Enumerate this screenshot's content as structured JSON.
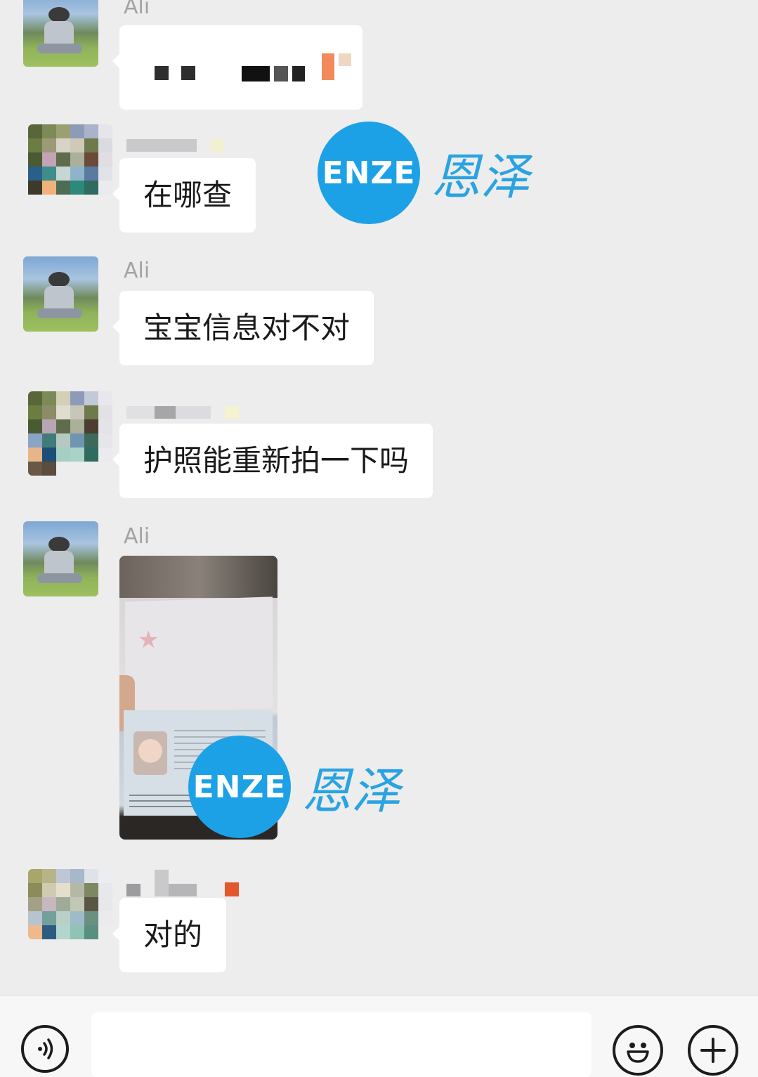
{
  "messages": [
    {
      "sender": "Ali",
      "type": "text",
      "text": ""
    },
    {
      "sender": "",
      "type": "text",
      "text": "在哪查"
    },
    {
      "sender": "Ali",
      "type": "text",
      "text": "宝宝信息对不对"
    },
    {
      "sender": "",
      "type": "text",
      "text": "护照能重新拍一下吗"
    },
    {
      "sender": "Ali",
      "type": "image",
      "text": ""
    },
    {
      "sender": "",
      "type": "text",
      "text": "对的"
    }
  ],
  "watermark": {
    "latin": "ENZE",
    "chinese": "恩泽",
    "color": "#1da1e6"
  },
  "input_bar": {
    "voice_icon": "voice-icon",
    "emoji_icon": "emoji-icon",
    "plus_icon": "plus-icon"
  }
}
